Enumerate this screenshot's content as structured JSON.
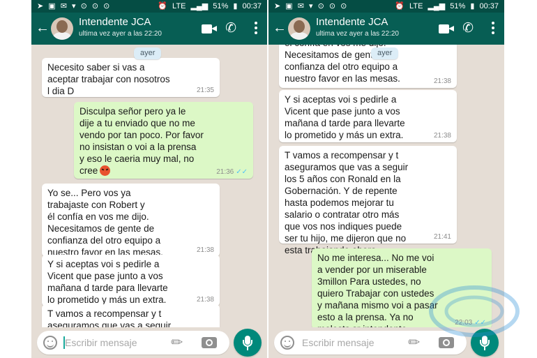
{
  "status_bar": {
    "network": "LTE",
    "battery": "51%",
    "time": "00:37"
  },
  "header": {
    "contact_name": "Intendente JCA",
    "last_seen": "ultima vez ayer a las 22:20"
  },
  "date_chip": "ayer",
  "input": {
    "placeholder": "Escribir mensaje"
  },
  "left_messages": [
    {
      "direction": "in",
      "text": "Necesito saber si vas a\naceptar trabajar con nosotros\nl dia D",
      "time": "21:35"
    },
    {
      "direction": "out",
      "text": "Disculpa señor pero ya le\ndije a tu enviado que no me\nvendo por tan poco. Por favor\nno insistan o voi a la prensa\ny eso le caeria muy mal, no\ncree",
      "time": "21:36"
    },
    {
      "direction": "in",
      "text": "Yo se... Pero vos ya\ntrabajaste con Robert y\nél confía en vos me dijo.\nNecesitamos de gente de\nconfianza del otro equipo a\nnuestro favor en las mesas.",
      "time": "21:38"
    },
    {
      "direction": "in",
      "text": "Y si aceptas voi s pedirle a\nVicent que pase junto a vos\nmañana d tarde para llevarte\nlo prometido y más un extra.",
      "time": "21:38"
    },
    {
      "direction": "in",
      "text": "T vamos a recompensar y t\naseguramos que vas a seguir",
      "time": ""
    }
  ],
  "right_messages": [
    {
      "direction": "in",
      "text": "el confía en vos me dijo.\nNecesitamos de gente de\nconfianza del otro equipo a\nnuestro favor en las mesas.",
      "time": "21:38"
    },
    {
      "direction": "in",
      "text": "Y si aceptas voi s pedirle a\nVicent que pase junto a vos\nmañana d tarde para llevarte\nlo prometido y más un extra.",
      "time": "21:38"
    },
    {
      "direction": "in",
      "text": "T vamos a recompensar y t\naseguramos que vas a seguir\nlos 5 años con Ronald en la\nGobernación. Y de repente\nhasta podemos mejorar tu\nsalario o contratar otro más\nque vos nos indiques puede\nser tu hijo, me dijeron que no\nesta trabajando ahora.",
      "time": "21:41"
    },
    {
      "direction": "out",
      "text": "No me interesa... No me voi\na vender por un miserable\n3millon Para ustedes, no\nquiero Trabajar con ustedes\ny mañana mismo voi a pasar\nesto a la prensa. Ya no\nmolests sr intendente",
      "time": "22:03"
    }
  ]
}
